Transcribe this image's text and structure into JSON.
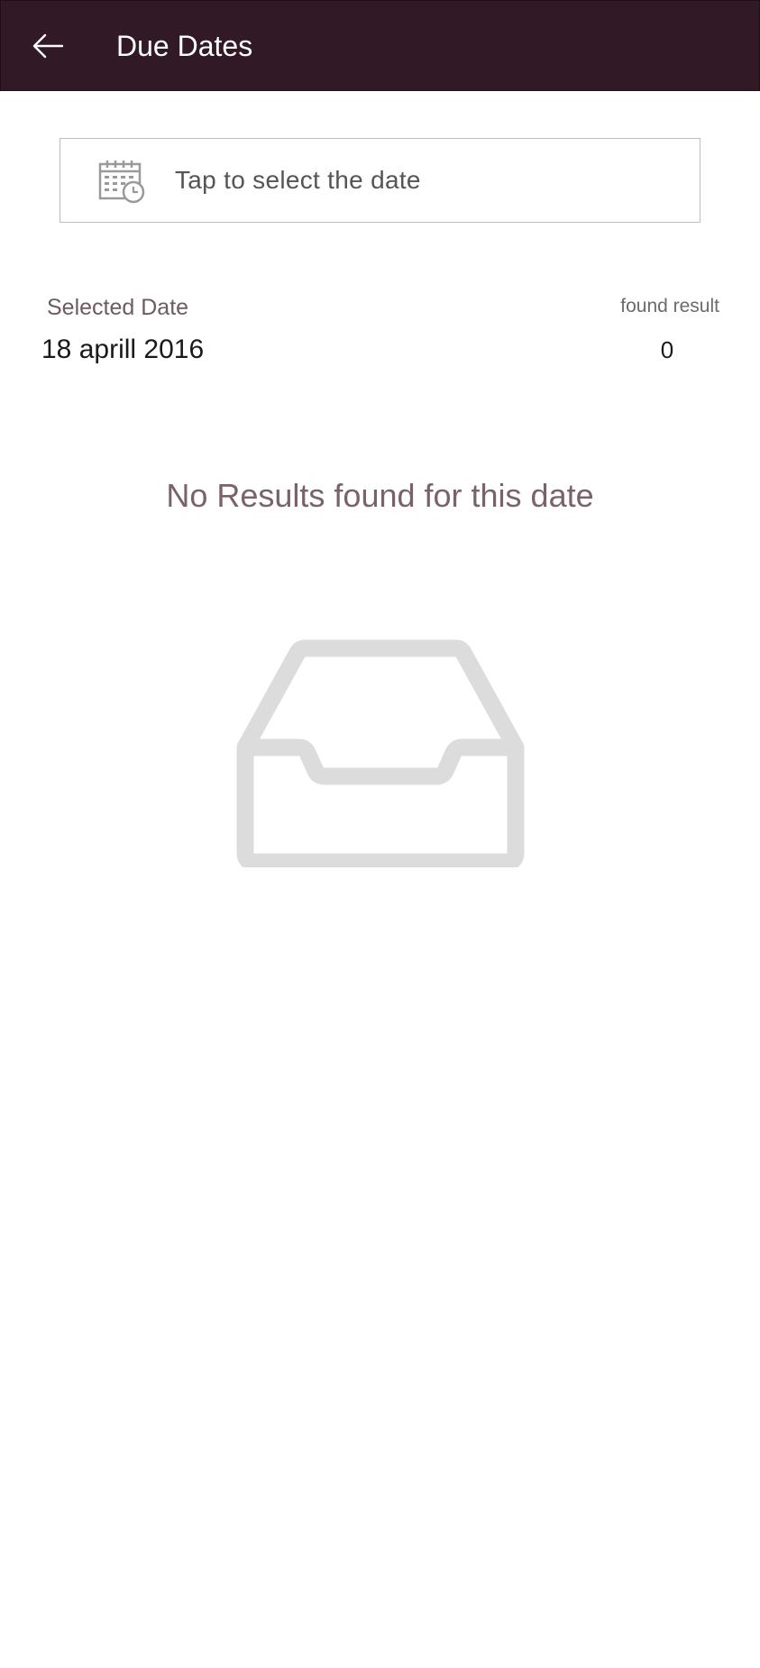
{
  "app_bar": {
    "title": "Due Dates",
    "back_icon": "arrow-left-icon",
    "background": "#311926"
  },
  "date_picker": {
    "placeholder": "Tap to select the date",
    "icon": "calendar-clock-icon"
  },
  "selected": {
    "label": "Selected Date",
    "value": "18 aprill 2016"
  },
  "found": {
    "label": "found result",
    "count": "0"
  },
  "empty_state": {
    "message": "No Results found for this date",
    "icon": "empty-inbox-icon"
  }
}
